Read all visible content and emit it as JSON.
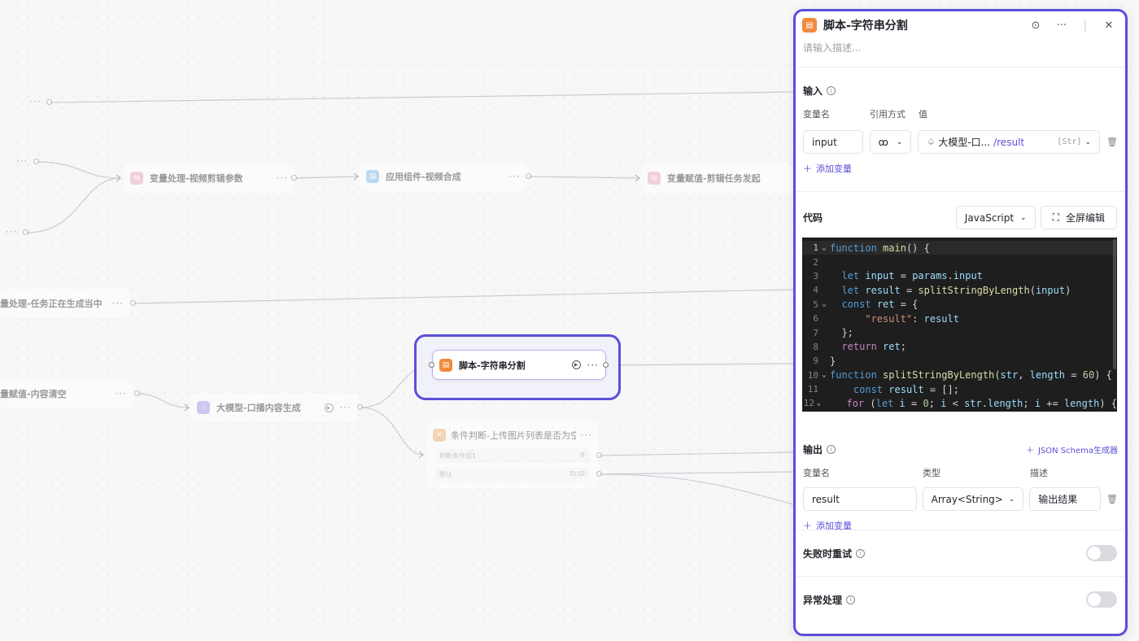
{
  "canvas": {
    "nodes": {
      "video_params": "变量处理-视频剪辑参数",
      "video_compose": "应用组件-视频合成",
      "cut_task": "变量赋值-剪辑任务发起",
      "task_generating": "量处理-任务正在生成当中",
      "content_clear": "量赋值-内容清空",
      "llm_gen": "大模型-口播内容生成",
      "selected": "脚本-字符串分割",
      "condition": {
        "title": "条件判断-上传图片列表是否为空",
        "branch_if_label": "判断条件组1",
        "branch_if": "IF",
        "branch_else_label": "默认",
        "branch_else": "ELSE"
      }
    },
    "dots": "···"
  },
  "panel": {
    "title": "脚本-字符串分割",
    "description_placeholder": "请输入描述...",
    "input": {
      "title": "输入",
      "col_name": "变量名",
      "col_ref": "引用方式",
      "col_value": "值",
      "var_name": "input",
      "ref_mode": "ꝏ",
      "ref_source": "大模型-口...",
      "ref_path": "/result",
      "ref_type": "[Str]",
      "add_variable": "添加变量"
    },
    "code": {
      "title": "代码",
      "language": "JavaScript",
      "fullscreen": "全屏编辑",
      "lines": [
        {
          "n": "1",
          "fold": "⌄"
        },
        {
          "n": "2",
          "fold": ""
        },
        {
          "n": "3",
          "fold": ""
        },
        {
          "n": "4",
          "fold": ""
        },
        {
          "n": "5",
          "fold": "⌄"
        },
        {
          "n": "6",
          "fold": ""
        },
        {
          "n": "7",
          "fold": ""
        },
        {
          "n": "8",
          "fold": ""
        },
        {
          "n": "9",
          "fold": ""
        },
        {
          "n": "10",
          "fold": "⌄"
        },
        {
          "n": "11",
          "fold": ""
        },
        {
          "n": "12",
          "fold": "⌄"
        }
      ],
      "tokens": {
        "l1a": "function",
        "l1b": "main",
        "l1c": "() {",
        "l3a": "let",
        "l3b": "input",
        "l3c": " = ",
        "l3d": "params",
        "l3e": ".",
        "l3f": "input",
        "l4a": "let",
        "l4b": "result",
        "l4c": " = ",
        "l4d": "splitStringByLength",
        "l4e": "(",
        "l4f": "input",
        "l4g": ")",
        "l5a": "const",
        "l5b": "ret",
        "l5c": " = {",
        "l6a": "\"result\"",
        "l6b": ": ",
        "l6c": "result",
        "l7": "};",
        "l8a": "return",
        "l8b": "ret",
        "l8c": ";",
        "l9": "}",
        "l10a": "function",
        "l10b": "splitStringByLength",
        "l10c": "(",
        "l10d": "str",
        "l10e": ", ",
        "l10f": "length",
        "l10g": " = ",
        "l10h": "60",
        "l10i": ") {",
        "l11a": "const",
        "l11b": "result",
        "l11c": " = [];",
        "l12a": "for",
        "l12b": " (",
        "l12c": "let",
        "l12d": "i",
        "l12e": " = ",
        "l12f": "0",
        "l12g": "; ",
        "l12h": "i",
        "l12i": " < ",
        "l12j": "str",
        "l12k": ".",
        "l12l": "length",
        "l12m": "; ",
        "l12n": "i",
        "l12o": " += ",
        "l12p": "length",
        "l12q": ") {"
      }
    },
    "output": {
      "title": "输出",
      "schema_link": "JSON Schema生成器",
      "col_name": "变量名",
      "col_type": "类型",
      "col_desc": "描述",
      "var_name": "result",
      "var_type": "Array<String>",
      "var_desc": "输出结果",
      "add_variable": "添加变量"
    },
    "retry_label": "失败时重试",
    "exception_label": "异常处理"
  }
}
